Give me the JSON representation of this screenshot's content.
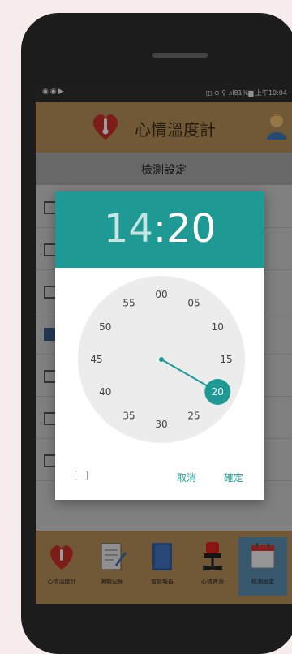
{
  "status_bar": {
    "left_icons": "◉◉▶",
    "right_text": "◫ ⊙ ⚲ .ıl81%▆ 上午10:04"
  },
  "app_bar": {
    "title": "心情溫度計"
  },
  "sub_bar": {
    "label": "檢測設定"
  },
  "list": {
    "rows": [
      {
        "checked": false
      },
      {
        "checked": false
      },
      {
        "checked": false
      },
      {
        "checked": true
      },
      {
        "checked": false
      },
      {
        "checked": false
      },
      {
        "checked": false
      }
    ]
  },
  "time_dialog": {
    "hour": "14",
    "separator": ":",
    "minute": "20",
    "selected_minute": "20",
    "clock_numbers": [
      "00",
      "05",
      "10",
      "15",
      "20",
      "25",
      "30",
      "35",
      "40",
      "45",
      "50",
      "55"
    ],
    "cancel_label": "取消",
    "ok_label": "確定"
  },
  "bottom_nav": {
    "items": [
      {
        "label": "心情溫度計",
        "icon": "heart-icon"
      },
      {
        "label": "測驗記錄",
        "icon": "record-icon"
      },
      {
        "label": "當前報告",
        "icon": "report-icon"
      },
      {
        "label": "心情資源",
        "icon": "resource-icon"
      },
      {
        "label": "檢測設定",
        "icon": "calendar-icon",
        "active": true
      }
    ]
  },
  "colors": {
    "accent": "#1e9994",
    "app_bar": "#b68f58",
    "active_tab": "#5b8fb2"
  }
}
